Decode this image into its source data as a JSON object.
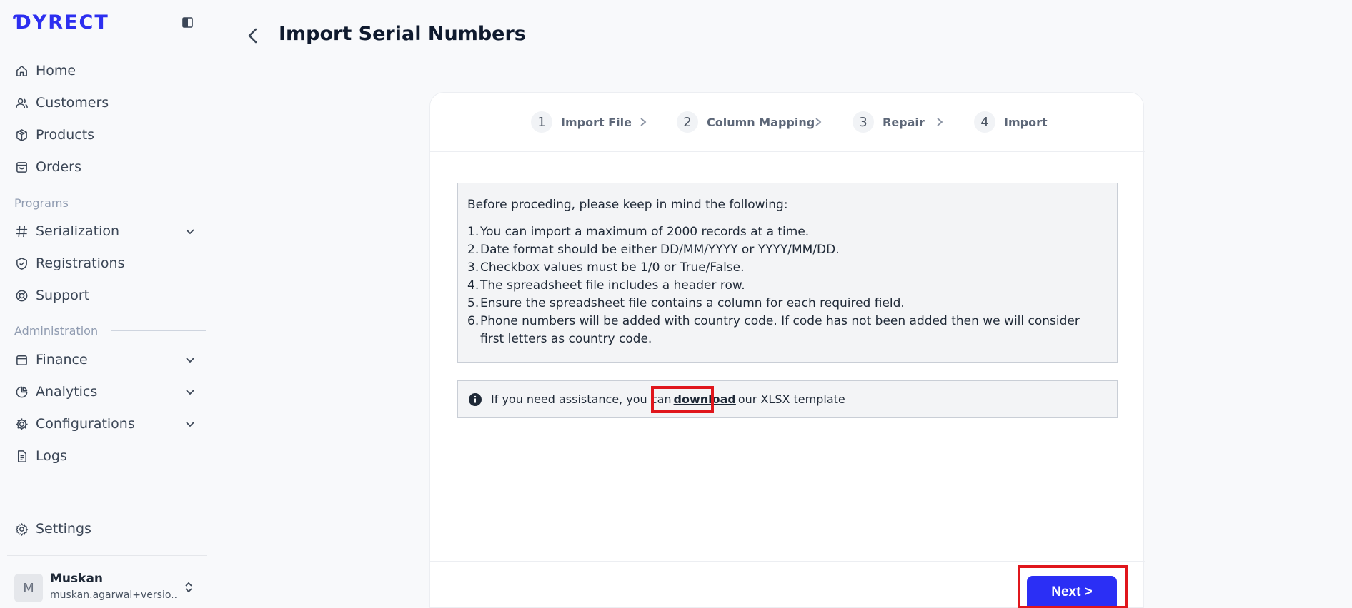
{
  "app": {
    "logo": "ƊYRECT"
  },
  "sidebar": {
    "items": [
      {
        "label": "Home",
        "icon": "home-icon"
      },
      {
        "label": "Customers",
        "icon": "users-icon"
      },
      {
        "label": "Products",
        "icon": "box-icon"
      },
      {
        "label": "Orders",
        "icon": "shopping-bag-icon"
      }
    ],
    "programs_label": "Programs",
    "program_items": [
      {
        "label": "Serialization",
        "icon": "hash-icon",
        "expandable": true
      },
      {
        "label": "Registrations",
        "icon": "shield-check-icon"
      },
      {
        "label": "Support",
        "icon": "lifebuoy-icon"
      }
    ],
    "administration_label": "Administration",
    "admin_items": [
      {
        "label": "Finance",
        "icon": "wallet-icon",
        "expandable": true
      },
      {
        "label": "Analytics",
        "icon": "pie-chart-icon",
        "expandable": true
      },
      {
        "label": "Configurations",
        "icon": "cog-icon",
        "expandable": true
      },
      {
        "label": "Logs",
        "icon": "file-text-icon"
      }
    ],
    "settings_label": "Settings",
    "user": {
      "initial": "M",
      "name": "Muskan",
      "email": "muskan.agarwal+versio..."
    }
  },
  "header": {
    "title": "Import Serial Numbers"
  },
  "stepper": [
    {
      "num": "1",
      "label": "Import File"
    },
    {
      "num": "2",
      "label": "Column Mapping"
    },
    {
      "num": "3",
      "label": "Repair"
    },
    {
      "num": "4",
      "label": "Import"
    }
  ],
  "notice": {
    "heading": "Before proceding, please keep in mind the following:",
    "items": [
      "You can import a maximum of 2000 records at a time.",
      "Date format should be either DD/MM/YYYY or YYYY/MM/DD.",
      "Checkbox values must be 1/0 or True/False.",
      "The spreadsheet file includes a header row.",
      "Ensure the spreadsheet file contains a column for each required field.",
      "Phone numbers will be added with country code. If code has not been added then we will consider first letters as country code."
    ]
  },
  "assist": {
    "prefix": "If you need assistance, you can",
    "link": "download",
    "suffix": "our XLSX template"
  },
  "footer": {
    "next_label": "Next >"
  },
  "colors": {
    "accent": "#2b2ff5",
    "highlight": "#e0161c"
  }
}
